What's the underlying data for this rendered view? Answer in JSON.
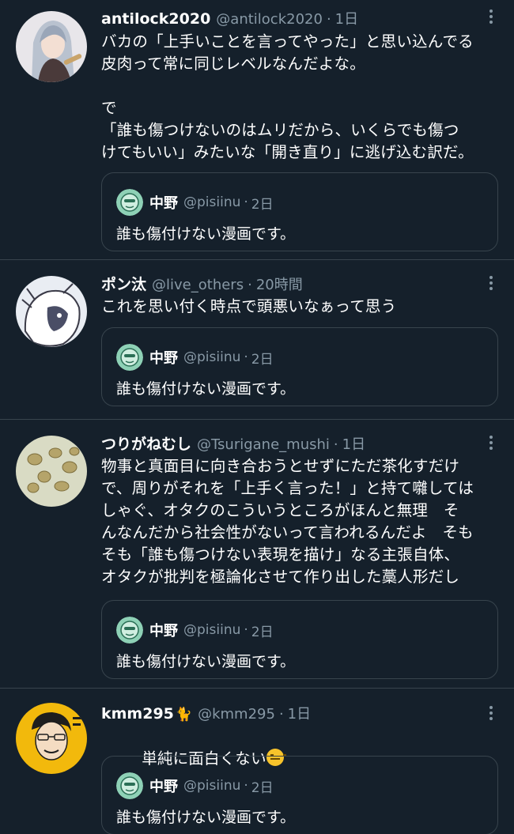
{
  "tweets": [
    {
      "name": "antilock2020",
      "badge": "",
      "handle": "@antilock2020",
      "time": "1日",
      "text": "バカの「上手いことを言ってやった」と思い込んでる\n皮肉って常に同じレベルなんだよな。\n\nで\n「誰も傷つけないのはムリだから、いくらでも傷つ\nけてもいい」みたいな「開き直り」に逃げ込む訳だ。",
      "emoji": "",
      "quote": {
        "name": "中野",
        "handle": "@pisiinu",
        "time": "2日",
        "text": "誰も傷付けない漫画です。"
      }
    },
    {
      "name": "ポン汰",
      "badge": "",
      "handle": "@live_others",
      "time": "20時間",
      "text": "これを思い付く時点で頭悪いなぁって思う",
      "emoji": "",
      "quote": {
        "name": "中野",
        "handle": "@pisiinu",
        "time": "2日",
        "text": "誰も傷付けない漫画です。"
      }
    },
    {
      "name": "つりがねむし",
      "badge": "",
      "handle": "@Tsurigane_mushi",
      "time": "1日",
      "text": "物事と真面目に向き合おうとせずにただ茶化すだけ\nで、周りがそれを「上手く言った！」と持て囃しては\nしゃぐ、オタクのこういうところがほんと無理　そ\nんなんだから社会性がないって言われるんだよ　そも\nそも「誰も傷つけない表現を描け」なる主張自体、\nオタクが批判を極論化させて作り出した藁人形だし",
      "emoji": "",
      "quote": {
        "name": "中野",
        "handle": "@pisiinu",
        "time": "2日",
        "text": "誰も傷付けない漫画です。"
      }
    },
    {
      "name": "kmm295",
      "badge": "🐈",
      "handle": "@kmm295",
      "time": "1日",
      "text": "単純に面白くない",
      "emoji": "expressionless-face-emoji",
      "quote": {
        "name": "中野",
        "handle": "@pisiinu",
        "time": "2日",
        "text": "誰も傷付けない漫画です。"
      }
    }
  ],
  "separator": "·",
  "icons": {
    "more": "more-vertical-icon",
    "quote_avatar": "green-face-avatar"
  },
  "colors": {
    "background": "#15202b",
    "border": "#38444d",
    "secondary_text": "#8899a6",
    "primary_text": "#ffffff"
  }
}
